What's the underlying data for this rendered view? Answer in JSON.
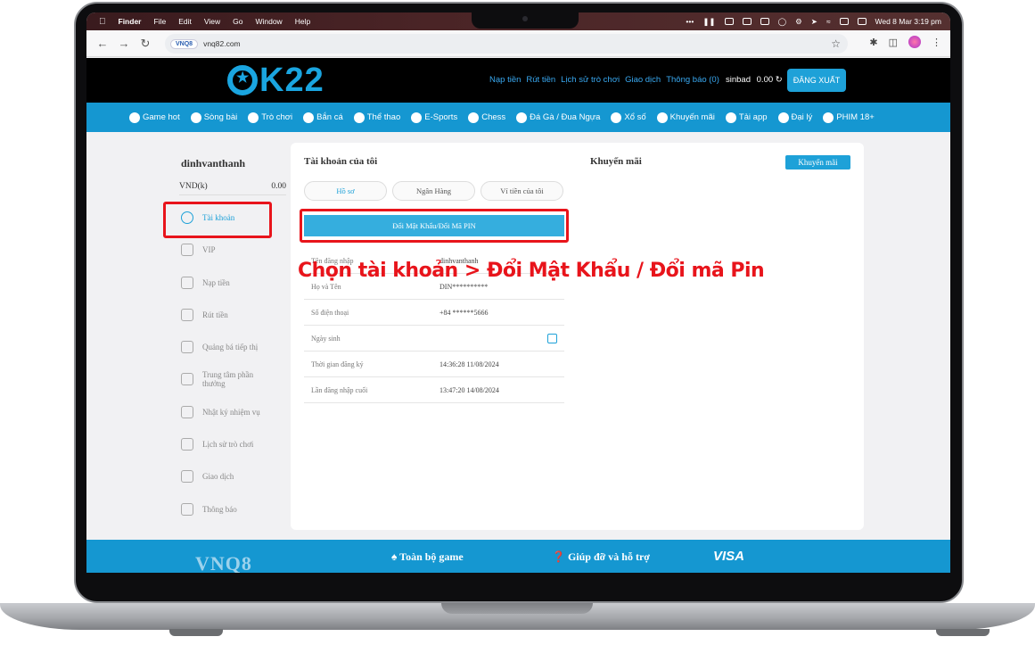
{
  "menubar": {
    "app": "Finder",
    "items": [
      "File",
      "Edit",
      "View",
      "Go",
      "Window",
      "Help"
    ],
    "clock": "Wed 8 Mar 3:19 pm"
  },
  "browser": {
    "site_badge": "VNQ8",
    "url": "vnq82.com"
  },
  "header": {
    "logo": "K22",
    "links": [
      "Nạp tiền",
      "Rút tiền",
      "Lịch sử trò chơi",
      "Giao dịch",
      "Thông báo (0)"
    ],
    "username": "sinbad",
    "balance": "0.00",
    "logout": "ĐĂNG XUẤT"
  },
  "nav": {
    "items": [
      {
        "label": "Game hot",
        "icon": "fire-icon"
      },
      {
        "label": "Sòng bài",
        "icon": "chip-icon"
      },
      {
        "label": "Trò chơi",
        "icon": "slot-icon"
      },
      {
        "label": "Bắn cá",
        "icon": "fish-icon"
      },
      {
        "label": "Thể thao",
        "icon": "ball-icon"
      },
      {
        "label": "E-Sports",
        "icon": "controller-icon"
      },
      {
        "label": "Chess",
        "icon": "chess-icon"
      },
      {
        "label": "Đá Gà / Đua Ngựa",
        "icon": "rooster-icon"
      },
      {
        "label": "Xổ số",
        "icon": "lottery-icon"
      },
      {
        "label": "Khuyến mãi",
        "icon": "gift-icon"
      },
      {
        "label": "Tải app",
        "icon": "link-icon"
      },
      {
        "label": "Đại lý",
        "icon": "agent-icon"
      },
      {
        "label": "PHIM 18+",
        "icon": "film-icon"
      }
    ]
  },
  "sidebar": {
    "username": "dinhvanthanh",
    "currency": "VND(k)",
    "balance": "0.00",
    "items": [
      {
        "label": "Tài khoản",
        "icon": "user-shield-icon"
      },
      {
        "label": "VIP",
        "icon": "vip-icon"
      },
      {
        "label": "Nạp tiền",
        "icon": "deposit-icon"
      },
      {
        "label": "Rút tiền",
        "icon": "withdraw-icon"
      },
      {
        "label": "Quảng bá tiếp thị",
        "icon": "promo-icon"
      },
      {
        "label": "Trung tâm phần thưởng",
        "icon": "reward-icon"
      },
      {
        "label": "Nhật ký nhiệm vụ",
        "icon": "task-icon"
      },
      {
        "label": "Lịch sử trò chơi",
        "icon": "history-icon"
      },
      {
        "label": "Giao dịch",
        "icon": "transaction-icon"
      },
      {
        "label": "Thông báo",
        "icon": "mail-icon"
      }
    ]
  },
  "account": {
    "title": "Tài khoản của tôi",
    "tabs": [
      "Hồ sơ",
      "Ngân Hàng",
      "Ví tiền của tôi"
    ],
    "change_pw": "Đổi Mật Khẩu/Đổi Mã PIN",
    "rows": [
      {
        "key": "Tên đăng nhập",
        "value": "dinhvanthanh"
      },
      {
        "key": "Họ và Tên",
        "value": "DIN**********"
      },
      {
        "key": "Số điện thoại",
        "value": "+84 ******5666"
      },
      {
        "key": "Ngày sinh",
        "value": ""
      },
      {
        "key": "Thời gian đăng ký",
        "value": "14:36:28 11/08/2024"
      },
      {
        "key": "Lần đăng nhập cuối",
        "value": "13:47:20 14/08/2024"
      }
    ]
  },
  "promo": {
    "title": "Khuyến mãi",
    "button": "Khuyến mãi"
  },
  "footer": {
    "logo": "VNQ8",
    "col_a": "Toàn bộ game",
    "col_b": "Giúp đỡ và hỗ trợ",
    "visa": "VISA"
  },
  "annotation": {
    "text": "Chọn tài khoản > Đổi Mật Khẩu / Đổi mã Pin",
    "color": "#e8141b"
  }
}
